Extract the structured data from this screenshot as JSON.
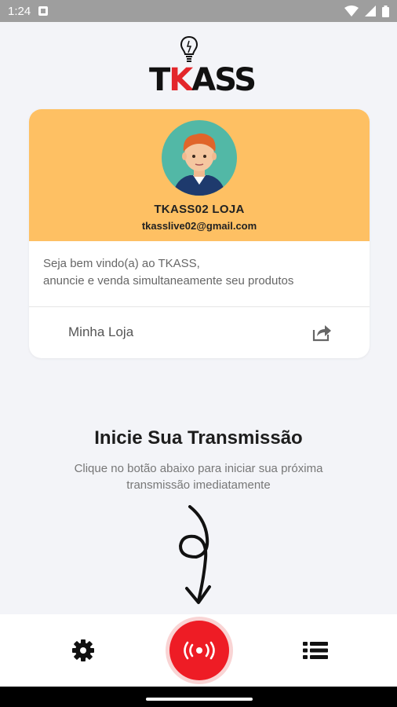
{
  "status_bar": {
    "time": "1:24",
    "icons": [
      "notification-icon",
      "wifi-icon",
      "signal-icon",
      "battery-icon"
    ]
  },
  "logo": {
    "text_prefix": "T",
    "text_accent": "K",
    "text_suffix": "ASS",
    "accent_color": "#e3262b"
  },
  "profile_card": {
    "header_color": "#fec063",
    "store_name": "TKASS02 LOJA",
    "email": "tkasslive02@gmail.com",
    "welcome_line1": "Seja bem vindo(a) ao TKASS,",
    "welcome_line2": "anuncie e venda simultaneamente seu produtos",
    "shop_link_label": "Minha Loja",
    "share_icon": "share-icon"
  },
  "broadcast": {
    "title": "Inicie Sua Transmissão",
    "subtitle_line1": "Clique no botão abaixo para iniciar sua próxima",
    "subtitle_line2": "transmissão imediatamente"
  },
  "bottom_nav": {
    "left_icon": "gear-icon",
    "center_icon": "live-broadcast-icon",
    "right_icon": "list-icon",
    "center_color": "#ee1c25"
  }
}
